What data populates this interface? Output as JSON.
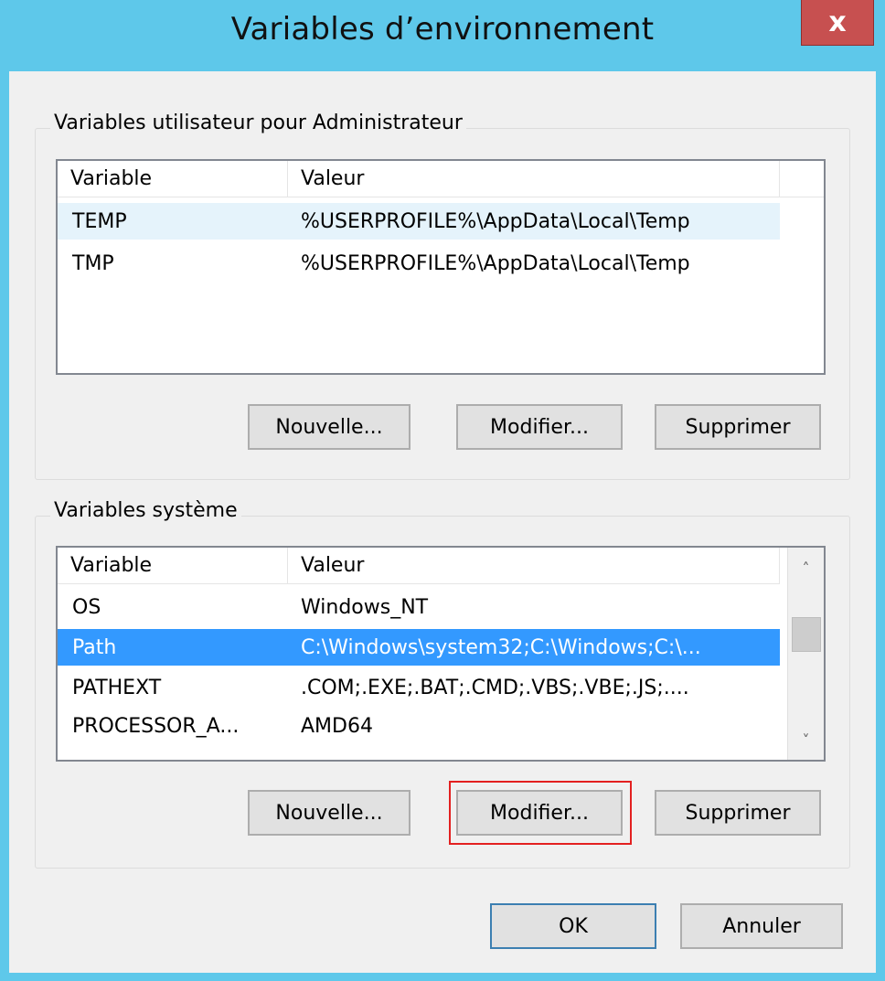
{
  "window": {
    "title": "Variables d’environnement",
    "close_label": "x"
  },
  "user_vars": {
    "group_label": "Variables utilisateur pour Administrateur",
    "columns": [
      "Variable",
      "Valeur"
    ],
    "rows": [
      {
        "name": "TEMP",
        "value": "%USERPROFILE%\\AppData\\Local\\Temp"
      },
      {
        "name": "TMP",
        "value": "%USERPROFILE%\\AppData\\Local\\Temp"
      }
    ],
    "buttons": {
      "new": "Nouvelle...",
      "edit": "Modifier...",
      "delete": "Supprimer"
    }
  },
  "system_vars": {
    "group_label": "Variables système",
    "columns": [
      "Variable",
      "Valeur"
    ],
    "rows": [
      {
        "name": "OS",
        "value": "Windows_NT"
      },
      {
        "name": "Path",
        "value": "C:\\Windows\\system32;C:\\Windows;C:\\..."
      },
      {
        "name": "PATHEXT",
        "value": ".COM;.EXE;.BAT;.CMD;.VBS;.VBE;.JS;...."
      },
      {
        "name": "PROCESSOR_A...",
        "value": "AMD64"
      }
    ],
    "selected_row": "Path",
    "buttons": {
      "new": "Nouvelle...",
      "edit": "Modifier...",
      "delete": "Supprimer"
    }
  },
  "footer": {
    "ok": "OK",
    "cancel": "Annuler"
  },
  "icons": {
    "scroll_up": "chevron-up-icon",
    "scroll_down": "chevron-down-icon"
  },
  "colors": {
    "title_bar": "#5ec8ea",
    "close_button": "#c75050",
    "selection": "#3399ff",
    "focus_highlight": "#e32020"
  }
}
